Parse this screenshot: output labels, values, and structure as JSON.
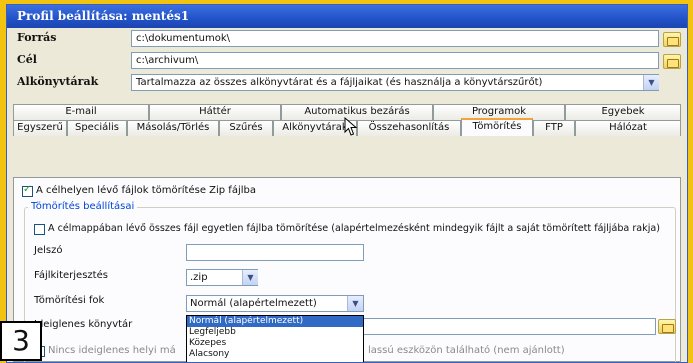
{
  "window": {
    "title": "Profil beállítása: mentés1"
  },
  "source": {
    "label": "Forrás",
    "value": "c:\\dokumentumok\\"
  },
  "target": {
    "label": "Cél",
    "value": "c:\\archivum\\"
  },
  "subfolders": {
    "label": "Alkönyvtárak",
    "value": "Tartalmazza az összes alkönyvtárat és a fájljaikat (és használja a könyvtárszűrőt)"
  },
  "tabs_row1": [
    "E-mail",
    "Háttér",
    "Automatikus bezárás",
    "Programok",
    "Egyebek"
  ],
  "tabs_row2": [
    "Egyszerű",
    "Speciális",
    "Másolás/Törlés",
    "Szűrés",
    "Alkönyvtárak",
    "Összehasonlítás",
    "Tömörítés",
    "FTP",
    "Hálózat"
  ],
  "active_tab": "Tömörítés",
  "compress": {
    "zip_checkbox_label": "A célhelyen lévő fájlok tömörítése Zip fájlba",
    "zip_checked": true,
    "group_title": "Tömörítés beállításai",
    "single_file_label": "A célmappában lévő összes fájl egyetlen fájlba tömörítése (alapértelmezésként mindegyik fájlt a saját tömörített fájljába rakja)",
    "single_file_checked": false,
    "password_label": "Jelszó",
    "password_value": "",
    "ext_label": "Fájlkiterjesztés",
    "ext_value": ".zip",
    "level_label": "Tömörítési fok",
    "level_value": "Normál (alapértelmezett)",
    "level_options": [
      "Normál (alapértelmezett)",
      "Legfeljebb",
      "Közepes",
      "Alacsony"
    ],
    "temp_label": "Ideiglenes könyvtár",
    "temp_value": "",
    "temp_check_label_left": "Nincs ideiglenes helyi má",
    "temp_check_label_right": "lassú eszközön található (nem ajánlott)"
  },
  "badge": "3"
}
